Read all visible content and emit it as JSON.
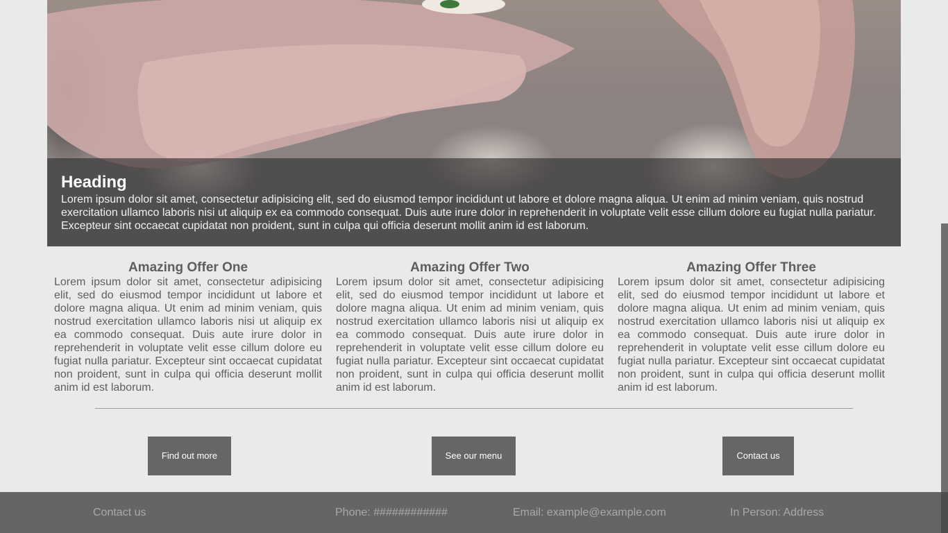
{
  "hero": {
    "heading": "Heading",
    "body": "Lorem ipsum dolor sit amet, consectetur adipisicing elit, sed do eiusmod tempor incididunt ut labore et dolore magna aliqua. Ut enim ad minim veniam, quis nostrud exercitation ullamco laboris nisi ut aliquip ex ea commodo consequat. Duis aute irure dolor in reprehenderit in voluptate velit esse cillum dolore eu fugiat nulla pariatur. Excepteur sint occaecat cupidatat non proident, sunt in culpa qui officia deserunt mollit anim id est laborum."
  },
  "offers": [
    {
      "title": "Amazing Offer One",
      "body": "Lorem ipsum dolor sit amet, consectetur adipisicing elit, sed do eiusmod tempor incididunt ut labore et dolore magna aliqua. Ut enim ad minim veniam, quis nostrud exercitation ullamco laboris nisi ut aliquip ex ea commodo consequat. Duis aute irure dolor in reprehenderit in voluptate velit esse cillum dolore eu fugiat nulla pariatur. Excepteur sint occaecat cupidatat non proident, sunt in culpa qui officia deserunt mollit anim id est laborum."
    },
    {
      "title": "Amazing Offer Two",
      "body": "Lorem ipsum dolor sit amet, consectetur adipisicing elit, sed do eiusmod tempor incididunt ut labore et dolore magna aliqua. Ut enim ad minim veniam, quis nostrud exercitation ullamco laboris nisi ut aliquip ex ea commodo consequat. Duis aute irure dolor in reprehenderit in voluptate velit esse cillum dolore eu fugiat nulla pariatur. Excepteur sint occaecat cupidatat non proident, sunt in culpa qui officia deserunt mollit anim id est laborum."
    },
    {
      "title": "Amazing Offer Three",
      "body": "Lorem ipsum dolor sit amet, consectetur adipisicing elit, sed do eiusmod tempor incididunt ut labore et dolore magna aliqua. Ut enim ad minim veniam, quis nostrud exercitation ullamco laboris nisi ut aliquip ex ea commodo consequat. Duis aute irure dolor in reprehenderit in voluptate velit esse cillum dolore eu fugiat nulla pariatur. Excepteur sint occaecat cupidatat non proident, sunt in culpa qui officia deserunt mollit anim id est laborum."
    }
  ],
  "buttons": {
    "find_out_more": "Find out more",
    "see_our_menu": "See our menu",
    "contact_us": "Contact us"
  },
  "footer": {
    "contact_label": "Contact us",
    "phone": "Phone: ############",
    "email": "Email: example@example.com",
    "in_person": "In Person: Address"
  },
  "colors": {
    "page_background": "#eaeaea",
    "button_background": "#666666",
    "footer_background": "#656565",
    "text": "#5e5e5e"
  }
}
